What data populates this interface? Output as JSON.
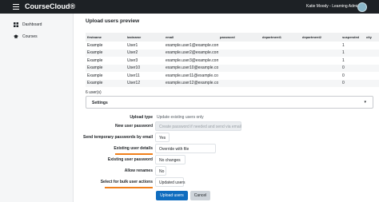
{
  "app": {
    "name": "CourseCloud®",
    "user_name": "Katie Moody - Learning Admin"
  },
  "nav": [
    {
      "label": "Dashboard",
      "icon": "dashboard-icon"
    },
    {
      "label": "Courses",
      "icon": "graduation-cap-icon"
    }
  ],
  "page": {
    "title": "Upload users preview"
  },
  "table": {
    "headers": [
      "firstname",
      "lastname",
      "email",
      "password",
      "department1",
      "department2",
      "suspended",
      "city"
    ],
    "rows": [
      [
        "Example",
        "User1",
        "example.user1@example.com",
        "",
        "",
        "",
        "1",
        ""
      ],
      [
        "Example",
        "User2",
        "example.user2@example.com",
        "",
        "",
        "",
        "1",
        ""
      ],
      [
        "Example",
        "User3",
        "example.user3@example.com",
        "",
        "",
        "",
        "1",
        ""
      ],
      [
        "Example",
        "User10",
        "example.user10@example.com",
        "",
        "",
        "",
        "0",
        ""
      ],
      [
        "Example",
        "User11",
        "example.user11@example.com",
        "",
        "",
        "",
        "0",
        ""
      ],
      [
        "Example",
        "User12",
        "example.user12@example.com",
        "",
        "",
        "",
        "0",
        ""
      ]
    ]
  },
  "user_count": "6 user(s)",
  "settings": {
    "label": "Settings"
  },
  "form": {
    "upload_type": {
      "label": "Upload type",
      "value": "Update existing users only"
    },
    "new_user_password": {
      "label": "New user password",
      "value": "Create password if needed and send via email"
    },
    "send_temp_passwords": {
      "label": "Send temporary passwords by email",
      "value": "Yes"
    },
    "existing_user_details": {
      "label": "Existing user details",
      "value": "Override with file"
    },
    "existing_user_password": {
      "label": "Existing user password",
      "value": "No changes"
    },
    "allow_renames": {
      "label": "Allow renames",
      "value": "No"
    },
    "bulk_actions": {
      "label": "Select for bulk user actions",
      "value": "Updated users"
    }
  },
  "buttons": {
    "upload": "Upload users",
    "cancel": "Cancel"
  },
  "colors": {
    "primary": "#0f6cbf",
    "highlight": "#f07f1a",
    "topbar": "#1d2125"
  }
}
